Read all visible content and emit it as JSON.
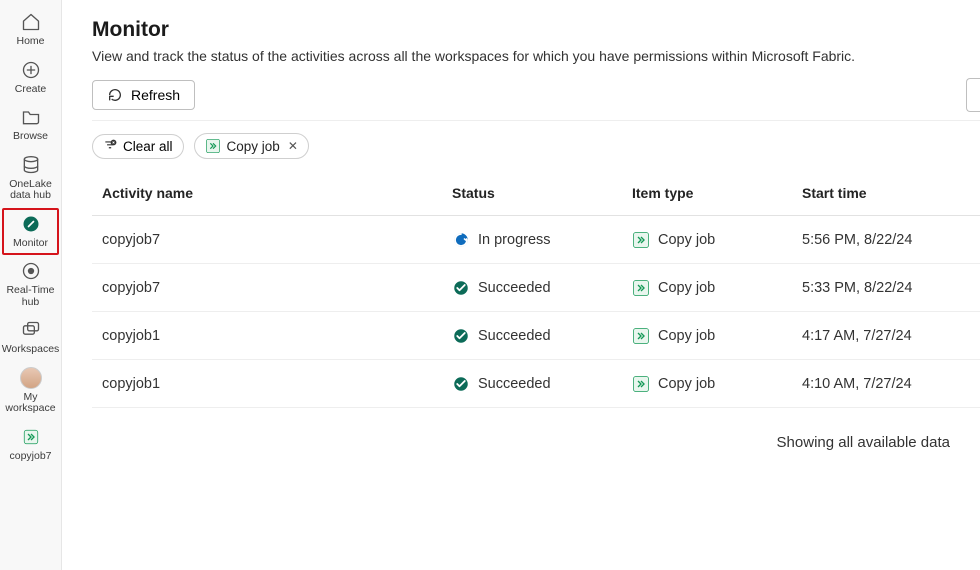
{
  "sidebar": {
    "items": [
      {
        "label": "Home"
      },
      {
        "label": "Create"
      },
      {
        "label": "Browse"
      },
      {
        "label": "OneLake data hub"
      },
      {
        "label": "Monitor"
      },
      {
        "label": "Real-Time hub"
      },
      {
        "label": "Workspaces"
      },
      {
        "label": "My workspace"
      },
      {
        "label": "copyjob7"
      }
    ]
  },
  "page": {
    "title": "Monitor",
    "subtitle": "View and track the status of the activities across all the workspaces for which you have permissions within Microsoft Fabric."
  },
  "toolbar": {
    "refresh_label": "Refresh",
    "clear_all_label": "Clear all"
  },
  "filters": {
    "chip_label": "Copy job"
  },
  "table": {
    "headers": {
      "activity": "Activity name",
      "status": "Status",
      "item_type": "Item type",
      "start_time": "Start time"
    },
    "rows": [
      {
        "activity": "copyjob7",
        "status": "In progress",
        "status_kind": "in_progress",
        "item_type": "Copy job",
        "start_time": "5:56 PM, 8/22/24"
      },
      {
        "activity": "copyjob7",
        "status": "Succeeded",
        "status_kind": "succeeded",
        "item_type": "Copy job",
        "start_time": "5:33 PM, 8/22/24"
      },
      {
        "activity": "copyjob1",
        "status": "Succeeded",
        "status_kind": "succeeded",
        "item_type": "Copy job",
        "start_time": "4:17 AM, 7/27/24"
      },
      {
        "activity": "copyjob1",
        "status": "Succeeded",
        "status_kind": "succeeded",
        "item_type": "Copy job",
        "start_time": "4:10 AM, 7/27/24"
      }
    ]
  },
  "footer": {
    "note": "Showing all available data"
  }
}
